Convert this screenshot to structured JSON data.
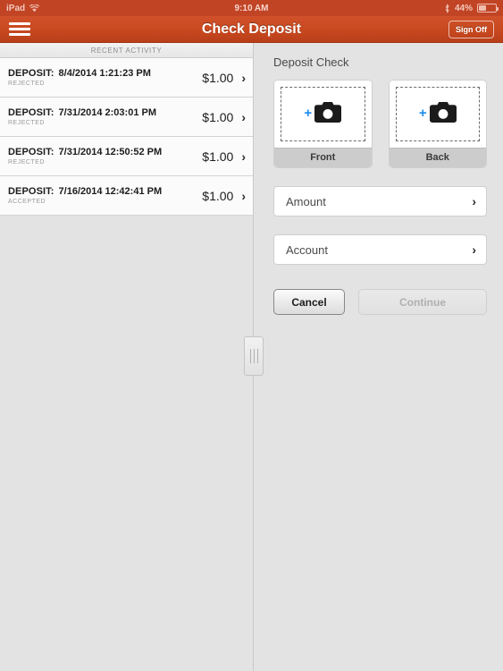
{
  "statusbar": {
    "device": "iPad",
    "wifi_icon": "wifi-icon",
    "time": "9:10 AM",
    "bluetooth_icon": "bluetooth-icon",
    "battery_percent": "44%",
    "battery_icon": "battery-icon"
  },
  "navbar": {
    "menu_icon": "hamburger-menu-icon",
    "title": "Check Deposit",
    "signoff_label": "Sign Off"
  },
  "activity": {
    "header": "RECENT ACTIVITY",
    "chevron_icon": "chevron-right-icon",
    "rows": [
      {
        "label": "DEPOSIT:",
        "datetime": "8/4/2014 1:21:23 PM",
        "status": "REJECTED",
        "amount": "$1.00"
      },
      {
        "label": "DEPOSIT:",
        "datetime": "7/31/2014 2:03:01 PM",
        "status": "REJECTED",
        "amount": "$1.00"
      },
      {
        "label": "DEPOSIT:",
        "datetime": "7/31/2014 12:50:52 PM",
        "status": "REJECTED",
        "amount": "$1.00"
      },
      {
        "label": "DEPOSIT:",
        "datetime": "7/16/2014 12:42:41 PM",
        "status": "ACCEPTED",
        "amount": "$1.00"
      }
    ]
  },
  "deposit": {
    "title": "Deposit Check",
    "plus_glyph": "+",
    "camera_icon": "camera-icon",
    "front_label": "Front",
    "back_label": "Back",
    "amount_label": "Amount",
    "account_label": "Account",
    "field_chevron_icon": "chevron-right-icon",
    "cancel_label": "Cancel",
    "continue_label": "Continue"
  },
  "split": {
    "handle_icon": "split-view-drag-handle"
  },
  "colors": {
    "brand_orange": "#c8481f",
    "status_bar": "#c14425",
    "accent_blue": "#1b8cf0",
    "pane_background": "#e3e3e3",
    "row_background": "#fbfbfb"
  }
}
